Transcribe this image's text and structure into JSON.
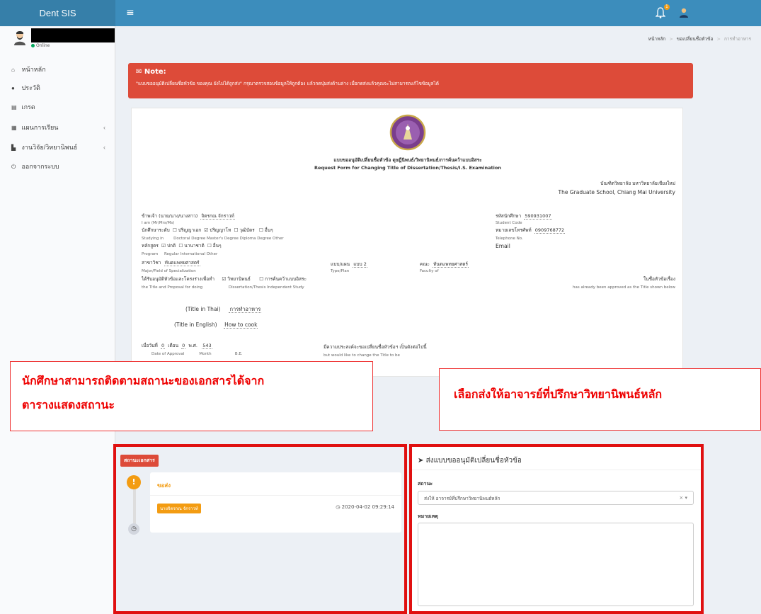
{
  "app": {
    "logo": "Dent SIS",
    "menu_icon": "hamburger-icon",
    "notification_count": "1"
  },
  "sidebar": {
    "status": "Online",
    "items": [
      {
        "label": "หน้าหลัก",
        "icon": "home-icon"
      },
      {
        "label": "ประวัติ",
        "icon": "user-icon"
      },
      {
        "label": "เกรด",
        "icon": "grade-icon"
      },
      {
        "label": "แผนการเรียน",
        "icon": "calendar-icon",
        "chevron": "‹"
      },
      {
        "label": "งานวิจัย/วิทยานิพนธ์",
        "icon": "book-icon",
        "chevron": "‹"
      },
      {
        "label": "ออกจากระบบ",
        "icon": "power-icon"
      }
    ]
  },
  "breadcrumb": {
    "items": [
      "หน้าหลัก",
      "ขอเปลี่ยนชื่อหัวข้อ"
    ],
    "current": "การทำอาหาร",
    "separator": ">"
  },
  "alert": {
    "title": "Note:",
    "message": "\"แบบขออนุมัติเปลี่ยนชื่อหัวข้อ ของคุณ ยังไม่ได้ถูกส่ง\" กรุณาตรวจสอบข้อมูลให้ถูกต้อง แล้วกดปุ่มส่งด้านล่าง เมื่อกดส่งแล้วคุณจะไม่สามารถแก้ไขข้อมูลได้"
  },
  "document": {
    "title_th": "แบบขออนุมัติเปลี่ยนชื่อหัวข้อ ดุษฎีนิพนธ์/วิทยานิพนธ์/การค้นคว้าแบบอิสระ",
    "title_en": "Request Form for Changing Title of Dissertation/Thesis/I.S. Examination",
    "school_th": "บัณฑิตวิทยาลัย มหาวิทยาลัยเชียงใหม่",
    "school_en": "The Graduate School, Chiang Mai University",
    "iam_th": "ข้าพเจ้า (นาย/นาง/นางสาว)",
    "iam_en": "I am (Mr/Mrs/Ms)",
    "name": "จิตรกณ จักราวท์",
    "student_code_th": "รหัสนักศึกษา",
    "student_code_en": "Student Code",
    "student_code": "590931007",
    "level_th": "นักศึกษาระดับ",
    "level_en": "Studying in",
    "degrees_th": [
      "ปริญญาเอก",
      "ปริญญาโท",
      "วุฒิบัตร",
      "อื่นๆ"
    ],
    "degrees_en": "Doctoral Degree   Master's Degree   Diploma Degree   Other",
    "phone_th": "หมายเลขโทรศัพท์",
    "phone_en": "Telephone No.",
    "phone": "0909768772",
    "email_label": "Email",
    "program_th": "หลักสูตร",
    "program_en": "Program",
    "programs_th": [
      "ปกติ",
      "นานาชาติ",
      "อื่นๆ"
    ],
    "programs_en": "Regular   International      Other",
    "major_th": "สาขาวิชา",
    "major_en": "Major/Field of Specialization",
    "major": "ทันตแพทยศาสตร์",
    "plan_th": "แบบ/แผน",
    "plan_en": "Type/Plan",
    "plan": "แบบ 2",
    "faculty_th": "คณะ",
    "faculty_en": "Faculty of",
    "faculty": "ทันตแพทยศาสตร์",
    "approved_th": "ได้รับอนุมัติหัวข้อและโครงร่างเพื่อทำ",
    "approved_en": "the Title and Proposal for doing",
    "approved_type_1": "วิทยานิพนธ์",
    "approved_type_2": "การค้นคว้าแบบอิสระ",
    "approved_types_en": "Dissertation/Thesis      Independent Study",
    "titled_th": "ในชื่อหัวข้อเรื่อง",
    "titled_en": "has already been approved as the Title shown below",
    "title_thai_label": "(Title in Thai)",
    "title_thai": "การทำอาหาร",
    "title_eng_label": "(Title in English)",
    "title_eng": "How to cook",
    "date_th": "เมื่อวันที่",
    "date_day": "0",
    "month_th": "เดือน",
    "date_month": "0",
    "be_th": "พ.ศ.",
    "date_year": "543",
    "date_en": "Date of Approval",
    "month_en": "Month",
    "be_en": "B.E.",
    "wish_th": "มีความประสงค์จะขอเปลี่ยนชื่อหัวข้อฯ เป็นดังต่อไปนี้",
    "wish_en": "but would like to change the Title to be"
  },
  "callouts": {
    "left_line1": "นักศึกษาสามารถติดตามสถานะของเอกสารได้จาก",
    "left_line2": "ตารางแสดงสถานะ",
    "right": "เลือกส่งให้อาจารย์ที่ปรึกษาวิทยานิพนธ์หลัก"
  },
  "status_panel": {
    "badge": "สถานะเอกสาร",
    "step_title": "ขอส่ง",
    "user": "นายจิตรกณ จักราวท์",
    "timestamp": "2020-04-02 09:29:14",
    "warning_glyph": "!",
    "clock_glyph": "◷"
  },
  "submit_panel": {
    "heading": "ส่งแบบขออนุมัติเปลี่ยนชื่อหัวข้อ",
    "status_label": "สถานะ",
    "status_value": "ส่งให้ อาจารย์ที่ปรึกษาวิทยานิพนธ์หลัก",
    "select_controls": "× ▾",
    "note_label": "หมายเหตุ",
    "note_value": ""
  }
}
